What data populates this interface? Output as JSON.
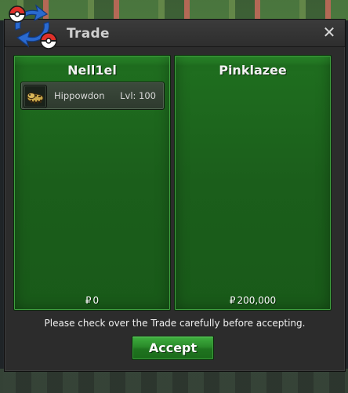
{
  "window": {
    "title": "Trade",
    "close_icon": "close-icon",
    "logo_icon": "trade-swap-icon"
  },
  "left_panel": {
    "player_name": "Nell1el",
    "items": [
      {
        "icon": "hippowdon-sprite-icon",
        "name": "Hippowdon",
        "level": "Lvl: 100"
      }
    ],
    "currency_symbol": "₽",
    "money": "0"
  },
  "right_panel": {
    "player_name": "Pinklazee",
    "items": [],
    "currency_symbol": "₽",
    "money": "200,000"
  },
  "notice": "Please check over the Trade carefully before accepting.",
  "accept_button": {
    "label": "Accept"
  },
  "colors": {
    "panel_green": "#1b5e1b",
    "button_green": "#2a8a2a",
    "window_dark": "#2c2c2c"
  }
}
